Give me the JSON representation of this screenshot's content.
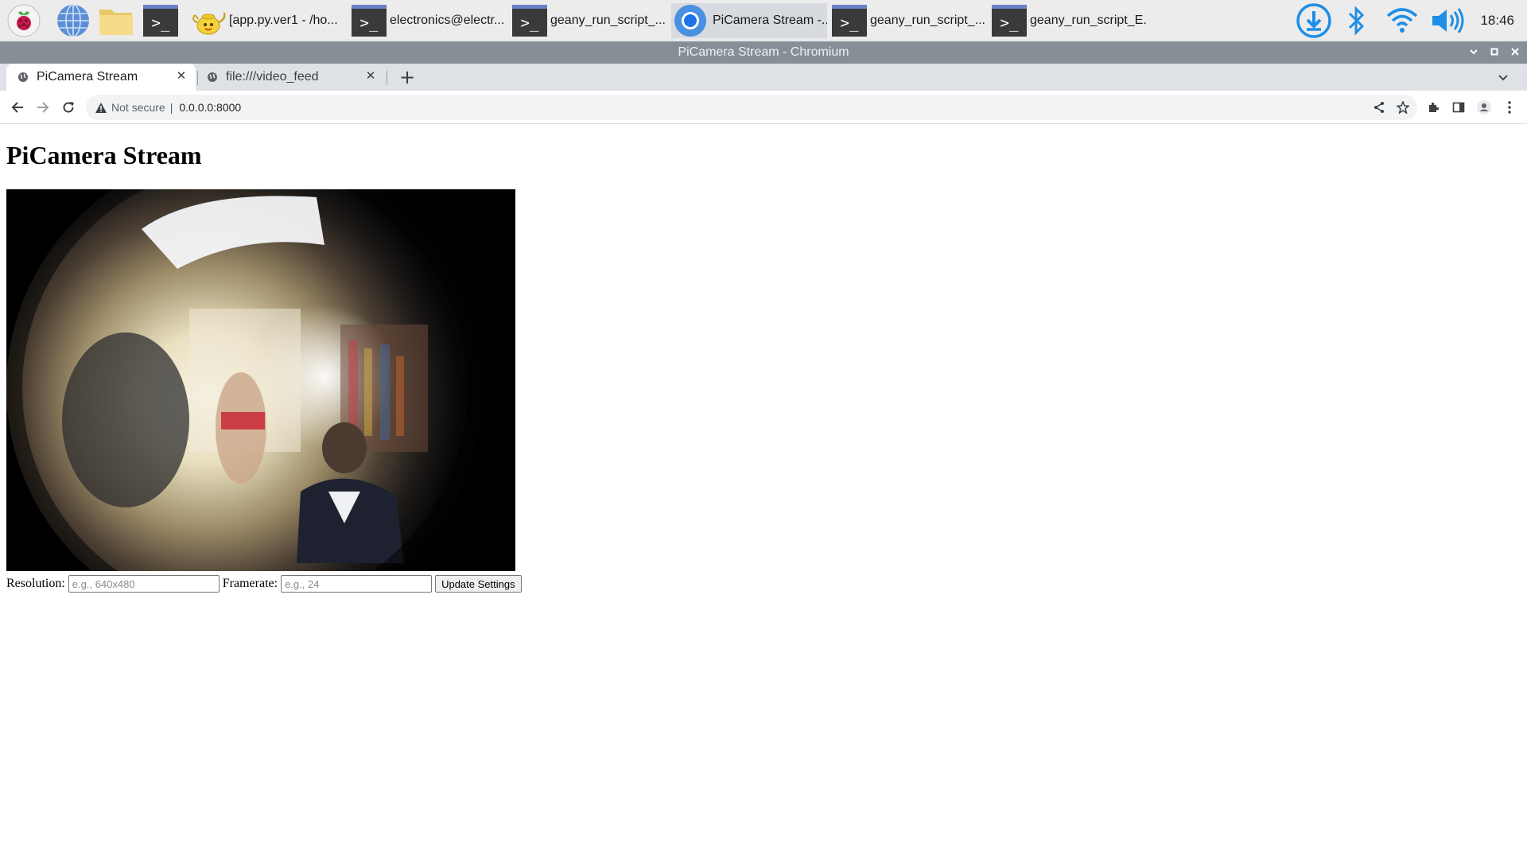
{
  "taskbar": {
    "windows": [
      {
        "label": "[app.py.ver1 - /ho...",
        "icon": "geany-teapot-icon"
      },
      {
        "label": "electronics@electr...",
        "icon": "terminal-icon"
      },
      {
        "label": "geany_run_script_...",
        "icon": "terminal-icon"
      },
      {
        "label": "PiCamera Stream -...",
        "icon": "chromium-icon",
        "active": true
      },
      {
        "label": "geany_run_script_...",
        "icon": "terminal-icon"
      },
      {
        "label": "geany_run_script_E...",
        "icon": "terminal-icon"
      }
    ],
    "clock": "18:46",
    "colors": {
      "tray_blue": "#1e8ee6",
      "terminal_bar": "#6b7fc9"
    }
  },
  "browser": {
    "window_title": "PiCamera Stream - Chromium",
    "tabs": [
      {
        "title": "PiCamera Stream",
        "active": true
      },
      {
        "title": "file:///video_feed",
        "active": false
      }
    ],
    "omnibox": {
      "security_label": "Not secure",
      "divider": "|",
      "url": "0.0.0.0:8000"
    }
  },
  "page": {
    "heading": "PiCamera Stream",
    "form": {
      "resolution_label": "Resolution:",
      "resolution_placeholder": "e.g., 640x480",
      "framerate_label": "Framerate:",
      "framerate_placeholder": "e.g., 24",
      "submit_label": "Update Settings"
    }
  }
}
